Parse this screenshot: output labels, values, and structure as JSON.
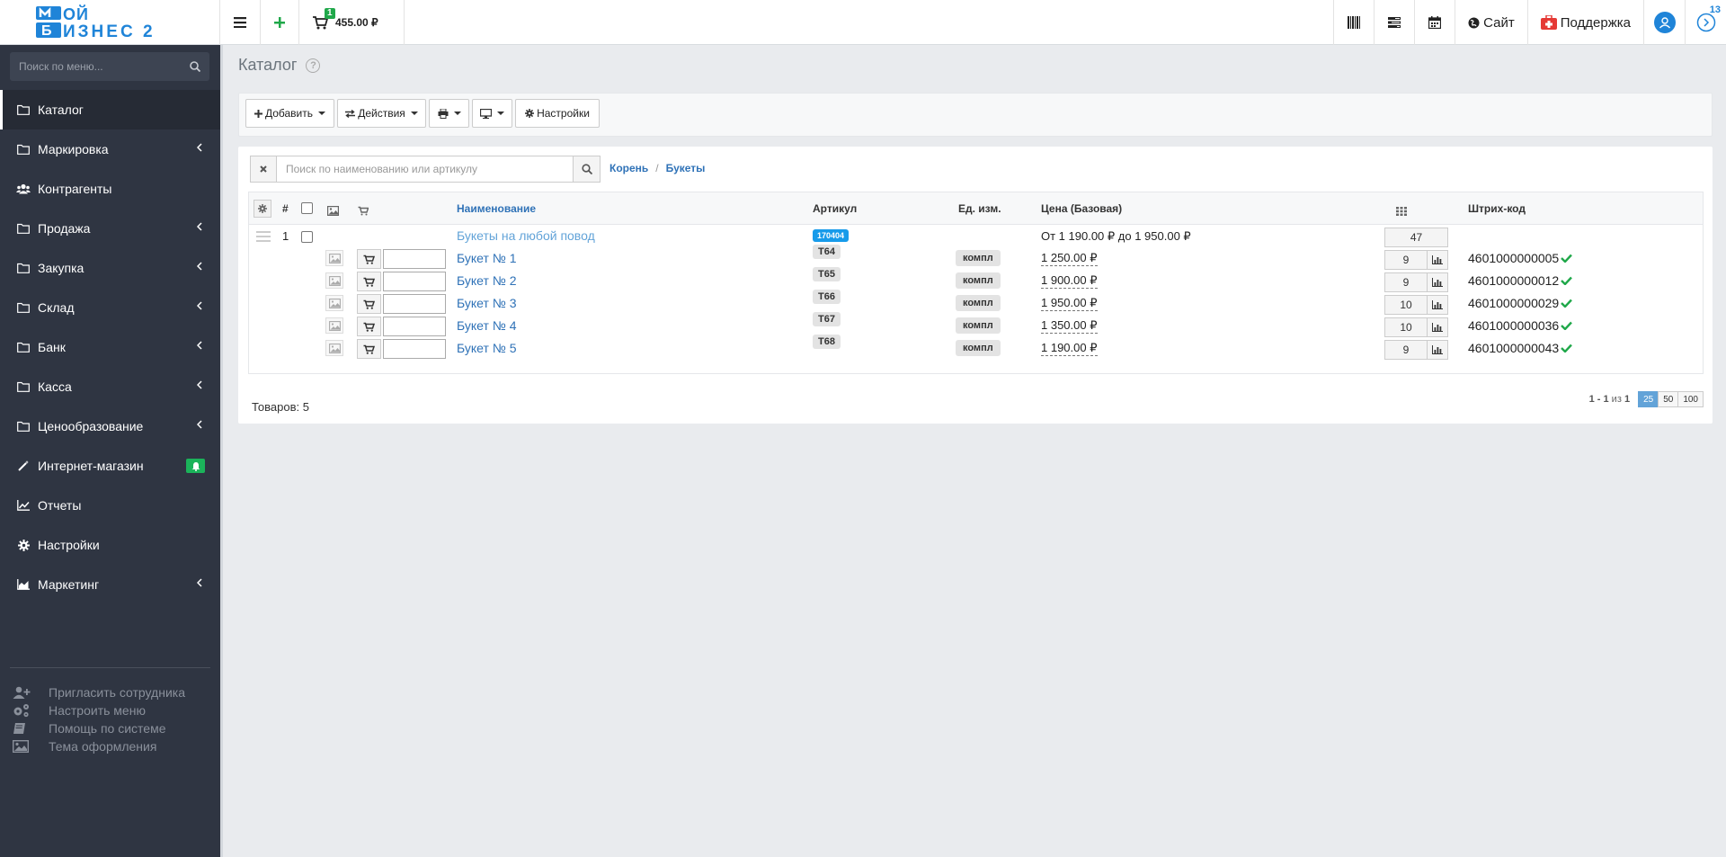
{
  "app": {
    "logo_alt": "Мой Бизнес 2",
    "cart_count": "1",
    "cart_total": "455.00 ₽",
    "site_label": "Сайт",
    "support_label": "Поддержка",
    "notifications_count": "13",
    "accent_color": "#1f84d8"
  },
  "sidebar": {
    "search_placeholder": "Поиск по меню...",
    "items": [
      {
        "label": "Каталог",
        "icon": "folder-icon",
        "active": true
      },
      {
        "label": "Маркировка",
        "icon": "folder-icon"
      },
      {
        "label": "Контрагенты",
        "icon": "users-icon"
      },
      {
        "label": "Продажа",
        "icon": "folder-icon"
      },
      {
        "label": "Закупка",
        "icon": "folder-icon"
      },
      {
        "label": "Склад",
        "icon": "folder-icon"
      },
      {
        "label": "Банк",
        "icon": "folder-icon"
      },
      {
        "label": "Касса",
        "icon": "folder-icon"
      },
      {
        "label": "Ценообразование",
        "icon": "folder-icon"
      },
      {
        "label": "Интернет-магазин",
        "icon": "magic-wand-icon"
      },
      {
        "label": "Отчеты",
        "icon": "line-chart-icon"
      },
      {
        "label": "Настройки",
        "icon": "gear-icon"
      },
      {
        "label": "Маркетинг",
        "icon": "area-chart-icon"
      }
    ],
    "extra": [
      {
        "label": "Пригласить сотрудника",
        "icon": "user-plus-icon"
      },
      {
        "label": "Настроить меню",
        "icon": "gears-icon"
      },
      {
        "label": "Помощь по системе",
        "icon": "book-icon"
      },
      {
        "label": "Тема оформления",
        "icon": "image-icon"
      }
    ]
  },
  "page": {
    "title": "Каталог",
    "help": "?"
  },
  "toolbar": {
    "add": "Добавить",
    "actions": "Действия",
    "settings": "Настройки"
  },
  "search": {
    "placeholder": "Поиск по наименованию или артикулу"
  },
  "breadcrumb": {
    "root": "Корень",
    "sep": "/",
    "current": "Букеты"
  },
  "table": {
    "headers": {
      "num": "#",
      "name": "Наименование",
      "article": "Артикул",
      "unit": "Ед. изм.",
      "price": "Цена (Базовая)",
      "barcode": "Штрих-код"
    },
    "group_row": {
      "num": "1",
      "name": "Букеты на любой повод",
      "article": "170404",
      "price": "От 1 190.00 ₽ до 1 950.00 ₽",
      "qty": "47"
    },
    "rows": [
      {
        "name": "Букет № 1",
        "article": "Т64",
        "unit": "компл",
        "price": "1 250.00 ₽",
        "qty": "9",
        "barcode": "4601000000005"
      },
      {
        "name": "Букет № 2",
        "article": "Т65",
        "unit": "компл",
        "price": "1 900.00 ₽",
        "qty": "9",
        "barcode": "4601000000012"
      },
      {
        "name": "Букет № 3",
        "article": "Т66",
        "unit": "компл",
        "price": "1 950.00 ₽",
        "qty": "10",
        "barcode": "4601000000029"
      },
      {
        "name": "Букет № 4",
        "article": "Т67",
        "unit": "компл",
        "price": "1 350.00 ₽",
        "qty": "10",
        "barcode": "4601000000036"
      },
      {
        "name": "Букет № 5",
        "article": "Т68",
        "unit": "компл",
        "price": "1 190.00 ₽",
        "qty": "9",
        "barcode": "4601000000043"
      }
    ]
  },
  "footer": {
    "count": "Товаров: 5",
    "range": "1 - 1",
    "of": "из",
    "total": "1",
    "page_sizes": [
      "25",
      "50",
      "100"
    ]
  }
}
